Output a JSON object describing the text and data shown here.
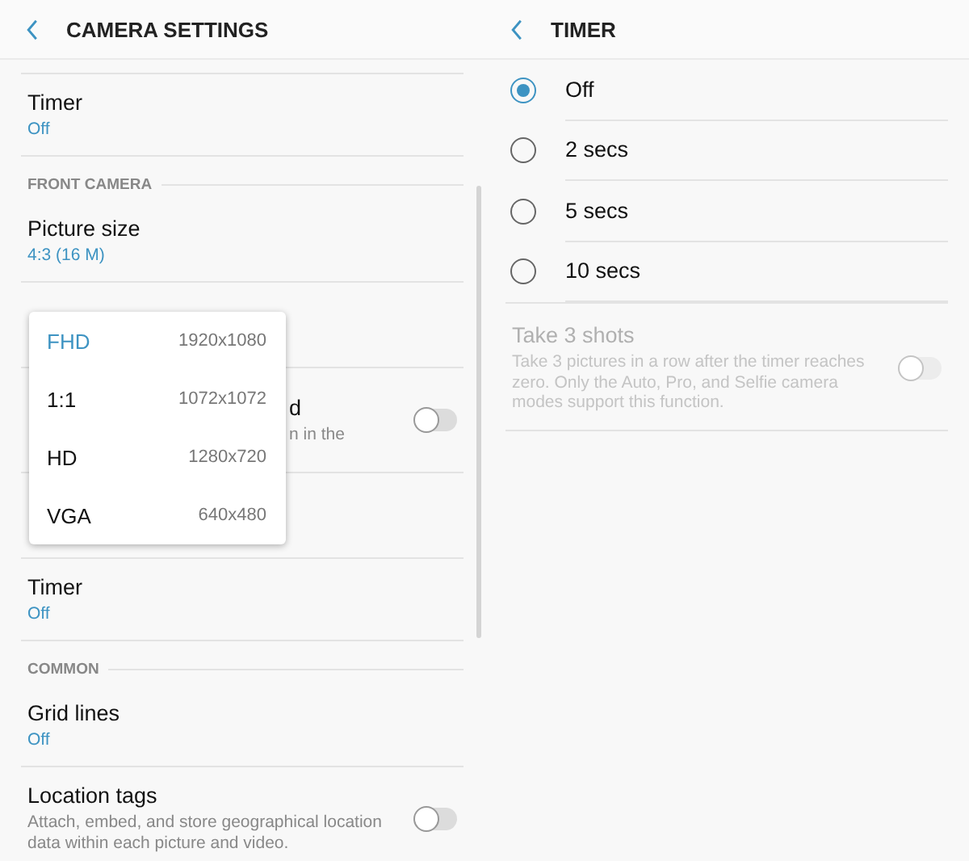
{
  "left": {
    "title": "CAMERA SETTINGS",
    "items": [
      {
        "kind": "setting",
        "title": "Timer",
        "value": "Off"
      },
      {
        "kind": "section",
        "title": "FRONT CAMERA"
      },
      {
        "kind": "setting",
        "title": "Picture size",
        "value": "4:3 (16 M)"
      },
      {
        "kind": "covered"
      },
      {
        "kind": "covered",
        "title": "d",
        "description": "n in the",
        "toggle": {
          "on": false
        }
      },
      {
        "kind": "covered"
      },
      {
        "kind": "setting",
        "title": "Timer",
        "value": "Off"
      },
      {
        "kind": "section",
        "title": "COMMON"
      },
      {
        "kind": "setting",
        "title": "Grid lines",
        "value": "Off"
      },
      {
        "kind": "setting",
        "title": "Location tags",
        "description": "Attach, embed, and store geographical location data within each picture and video.",
        "toggle": {
          "on": false
        }
      }
    ],
    "popup": [
      {
        "label": "FHD",
        "resolution": "1920x1080",
        "selected": true
      },
      {
        "label": "1:1",
        "resolution": "1072x1072",
        "selected": false
      },
      {
        "label": "HD",
        "resolution": "1280x720",
        "selected": false
      },
      {
        "label": "VGA",
        "resolution": "640x480",
        "selected": false
      }
    ]
  },
  "right": {
    "title": "TIMER",
    "options": [
      {
        "label": "Off",
        "selected": true
      },
      {
        "label": "2 secs",
        "selected": false
      },
      {
        "label": "5 secs",
        "selected": false
      },
      {
        "label": "10 secs",
        "selected": false
      }
    ],
    "take_shots": {
      "title": "Take 3 shots",
      "description": "Take 3 pictures in a row after the timer reaches zero. Only the Auto, Pro, and Selfie camera modes support this function.",
      "disabled": true,
      "toggle": {
        "on": false
      }
    }
  }
}
